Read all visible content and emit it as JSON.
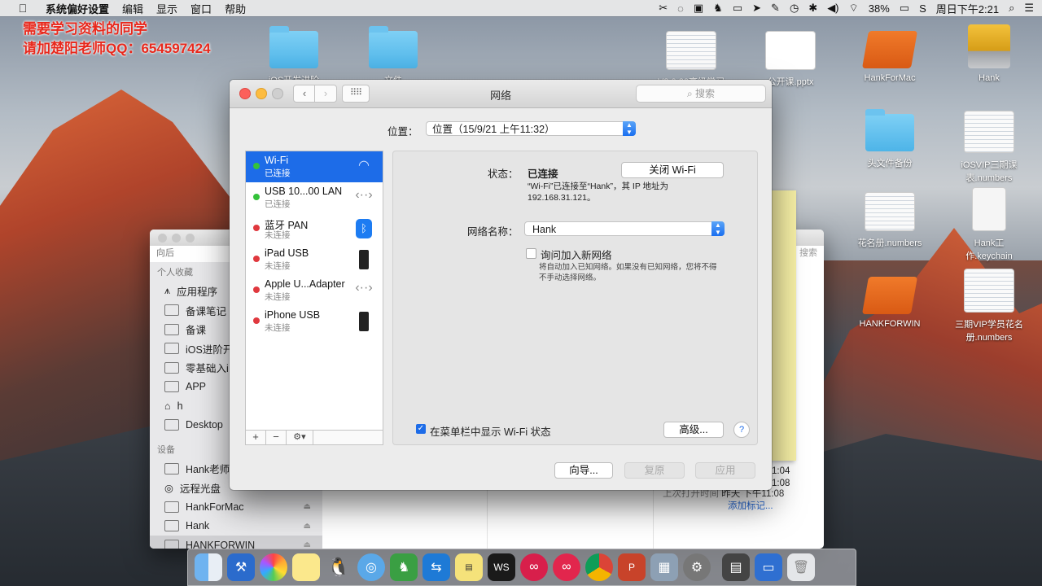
{
  "menubar": {
    "apple": "",
    "app_name": "系统偏好设置",
    "menus": [
      "编辑",
      "显示",
      "窗口",
      "帮助"
    ],
    "battery": "38%",
    "clock": "周日下午2:21"
  },
  "watermark": {
    "line1": "需要学习资料的同学",
    "line2": "请加楚阳老师QQ：654597424"
  },
  "desktop": {
    "icons": [
      {
        "label": "iOS开发进阶",
        "type": "folder"
      },
      {
        "label": "文件",
        "type": "folder"
      },
      {
        "label": "V3.0 20高级学习课",
        "type": "doc"
      },
      {
        "label": "公开课.pptx",
        "type": "doc"
      },
      {
        "label": "HankForMac",
        "type": "drive-orange"
      },
      {
        "label": "Hank",
        "type": "drive-yellow"
      },
      {
        "label": "头文件备份",
        "type": "folder"
      },
      {
        "label": "iOSVIP三期课表.numbers",
        "type": "doc"
      },
      {
        "label": "花名册.numbers",
        "type": "doc"
      },
      {
        "label": "Hank工作.keychain",
        "type": "blank"
      },
      {
        "label": "HANKFORWIN",
        "type": "drive-orange"
      },
      {
        "label": "三期VIP学员花名册.numbers",
        "type": "doc"
      }
    ]
  },
  "finder": {
    "back_label": "向后",
    "search_label": "搜索",
    "favorites_header": "个人收藏",
    "favorites": [
      "应用程序",
      "备课笔记",
      "备课",
      "iOS进阶开",
      "零基础入i",
      "APP",
      "h",
      "Desktop"
    ],
    "devices_header": "设备",
    "devices": [
      "Hank老师",
      "远程光盘",
      "HankForMac",
      "Hank",
      "HANKFORWIN"
    ],
    "times": [
      "1:04",
      "1:08",
      "下午11:08"
    ],
    "last_opened_label": "上次打开时间",
    "last_opened_value": "昨天 下午11:08",
    "add_tag": "添加标记..."
  },
  "window": {
    "title": "网络",
    "search_placeholder": "搜索",
    "grid_icon": "grid-icon",
    "location_label": "位置：",
    "location_value": "位置（15/9/21 上午11:32）",
    "services": [
      {
        "name": "Wi-Fi",
        "status": "已连接",
        "dot": "green",
        "icon": "wifi-icon",
        "selected": true
      },
      {
        "name": "USB 10...00 LAN",
        "status": "已连接",
        "dot": "green",
        "icon": "ethernet-icon"
      },
      {
        "name": "蓝牙 PAN",
        "status": "未连接",
        "dot": "red",
        "icon": "bluetooth-icon"
      },
      {
        "name": "iPad USB",
        "status": "未连接",
        "dot": "red",
        "icon": "iphone-icon"
      },
      {
        "name": "Apple U...Adapter",
        "status": "未连接",
        "dot": "red",
        "icon": "ethernet-icon"
      },
      {
        "name": "iPhone USB",
        "status": "未连接",
        "dot": "red",
        "icon": "iphone-icon"
      }
    ],
    "list_tools": [
      "+",
      "−",
      "⚙▾"
    ],
    "detail": {
      "status_label": "状态：",
      "status_value": "已连接",
      "wifi_button": "关闭 Wi-Fi",
      "description": "“Wi-Fi”已连接至“Hank”，其 IP 地址为 192.168.31.121。",
      "ssid_label": "网络名称：",
      "ssid_value": "Hank",
      "ask_join_label": "询问加入新网络",
      "ask_join_note": "将自动加入已知网络。如果没有已知网络，您将不得不手动选择网络。",
      "show_in_menubar_label": "在菜单栏中显示 Wi-Fi 状态",
      "advanced_button": "高级...",
      "help_button": "?"
    },
    "assist_button": "向导...",
    "revert_button": "复原",
    "apply_button": "应用"
  },
  "dock": {
    "apps": [
      "finder-icon",
      "xcode-icon",
      "photos-icon",
      "notes-icon",
      "qq-icon",
      "safari-icon",
      "evernote-icon",
      "teamviewer-icon",
      "stickies-icon",
      "webstorm-icon",
      "infuse-icon",
      "flickr-icon",
      "chrome-icon",
      "powerpoint-icon",
      "preview-icon",
      "system-preferences-icon",
      "downloads-icon",
      "keynote-icon",
      "trash-icon"
    ]
  }
}
